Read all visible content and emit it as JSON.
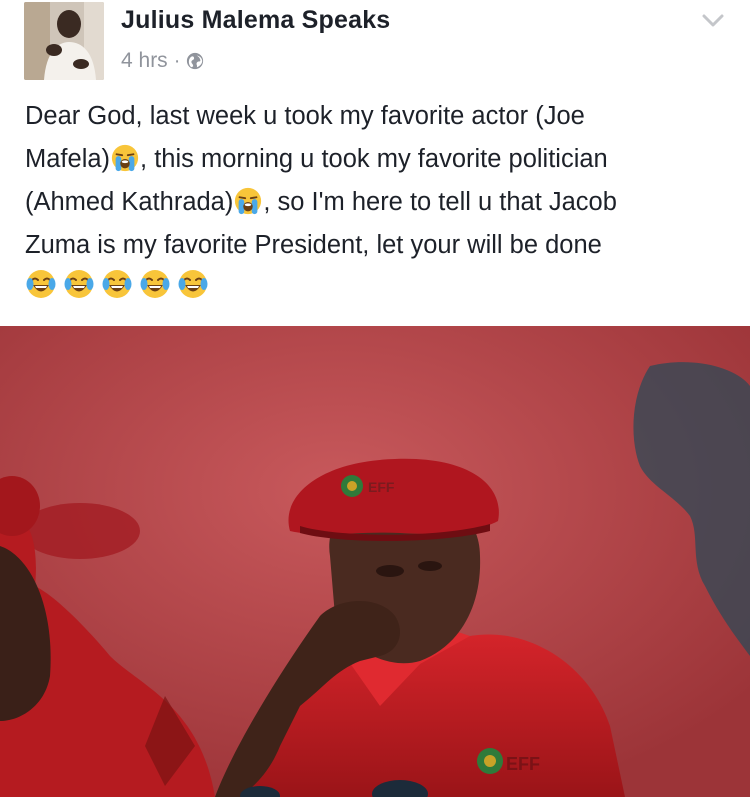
{
  "post": {
    "author": "Julius Malema Speaks",
    "timestamp": "4 hrs",
    "separator": "·",
    "privacy_icon": "globe-icon",
    "options_icon": "chevron-down-icon",
    "message": {
      "line1": "Dear God, last week u took my favorite actor (Joe",
      "line2_a": "Mafela)",
      "line2_b": ", this morning u took my favorite politician",
      "line3_a": "(Ahmed Kathrada)",
      "line3_b": ", so I'm here to tell u that Jacob",
      "line4": "Zuma is my favorite President, let your will be done"
    },
    "inline_emoji": "loudly-crying-face-icon",
    "trailing_emoji": "face-with-tears-of-joy-icon",
    "trailing_emoji_count": 5,
    "photo_caption_text": "EFF"
  },
  "colors": {
    "author": "#1d2129",
    "meta": "#90949c",
    "photo_wall": "#b4494f",
    "beret": "#b0161f",
    "shirt": "#c91c1f"
  }
}
